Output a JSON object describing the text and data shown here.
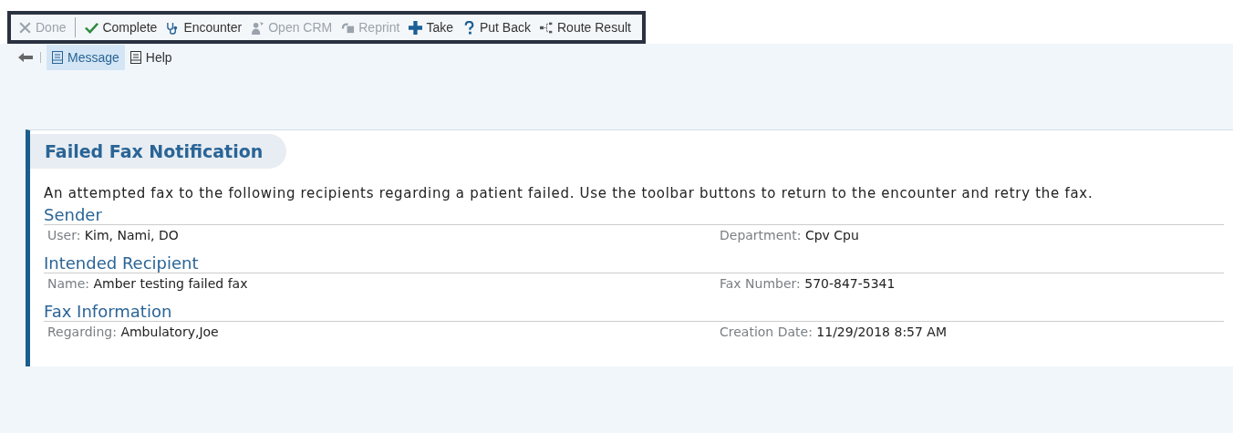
{
  "toolbar": {
    "items": [
      {
        "label": "Done",
        "disabled": true
      },
      {
        "label": "Complete",
        "disabled": false
      },
      {
        "label": "Encounter",
        "disabled": false
      },
      {
        "label": "Open CRM",
        "disabled": true
      },
      {
        "label": "Reprint",
        "disabled": true
      },
      {
        "label": "Take",
        "disabled": false
      },
      {
        "label": "Put Back",
        "disabled": false
      },
      {
        "label": "Route Result",
        "disabled": false
      }
    ]
  },
  "tabs": [
    {
      "label": "Message",
      "selected": true
    },
    {
      "label": "Help",
      "selected": false
    }
  ],
  "message": {
    "title": "Failed Fax Notification",
    "description": "An attempted fax to the following recipients regarding a patient failed. Use the toolbar buttons to return to the encounter and retry the fax.",
    "sections": [
      {
        "heading": "Sender",
        "fields": [
          {
            "label": "User:",
            "value": "Kim, Nami, DO"
          },
          {
            "label": "Department:",
            "value": "Cpv Cpu"
          }
        ]
      },
      {
        "heading": "Intended Recipient",
        "fields": [
          {
            "label": "Name:",
            "value": "Amber testing failed fax"
          },
          {
            "label": "Fax Number:",
            "value": "570-847-5341"
          }
        ]
      },
      {
        "heading": "Fax Information",
        "fields": [
          {
            "label": "Regarding:",
            "value": "Ambulatory,Joe"
          },
          {
            "label": "Creation Date:",
            "value": "11/29/2018  8:57 AM"
          }
        ]
      }
    ]
  }
}
